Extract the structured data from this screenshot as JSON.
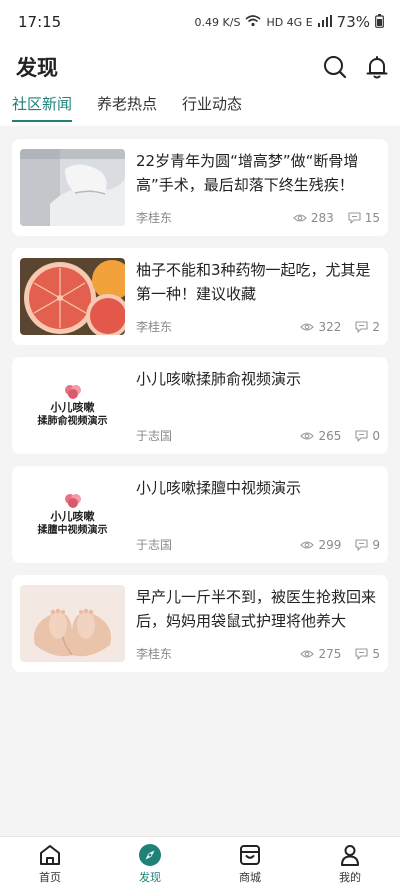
{
  "status": {
    "time": "17:15",
    "speed": "0.49 K/S",
    "net": "HD 4G E",
    "battery": "73%"
  },
  "header": {
    "title": "发现"
  },
  "tabs": [
    "社区新闻",
    "养老热点",
    "行业动态"
  ],
  "articles": [
    {
      "title": "22岁青年为圆“增高梦”做“断骨增高”手术，最后却落下终生残疾！",
      "author": "李桂东",
      "views": "283",
      "comments": "15"
    },
    {
      "title": "柚子不能和3种药物一起吃，尤其是第一种！建议收藏",
      "author": "李桂东",
      "views": "322",
      "comments": "2"
    },
    {
      "title": "小儿咳嗽揉肺俞视频演示",
      "author": "于志国",
      "views": "265",
      "comments": "0",
      "thumb_line1": "小儿咳嗽",
      "thumb_line2": "揉肺俞视频演示"
    },
    {
      "title": "小儿咳嗽揉膻中视频演示",
      "author": "于志国",
      "views": "299",
      "comments": "9",
      "thumb_line1": "小儿咳嗽",
      "thumb_line2": "揉膻中视频演示"
    },
    {
      "title": "早产儿一斤半不到，被医生抢救回来后，妈妈用袋鼠式护理将他养大",
      "author": "李桂东",
      "views": "275",
      "comments": "5"
    }
  ],
  "nav": [
    "首页",
    "发现",
    "商城",
    "我的"
  ]
}
